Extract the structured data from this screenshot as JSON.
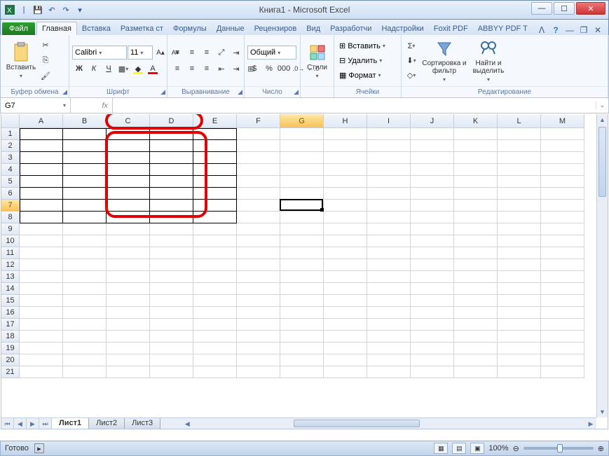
{
  "window": {
    "title": "Книга1  -  Microsoft Excel"
  },
  "qat": {
    "save": "💾",
    "undo": "↶",
    "redo": "↷"
  },
  "tabs": {
    "file": "Файл",
    "items": [
      "Главная",
      "Вставка",
      "Разметка ст",
      "Формулы",
      "Данные",
      "Рецензиров",
      "Вид",
      "Разработчи",
      "Надстройки",
      "Foxit PDF",
      "ABBYY PDF T"
    ],
    "active": 0
  },
  "ribbon": {
    "clipboard": {
      "paste": "Вставить",
      "label": "Буфер обмена"
    },
    "font": {
      "name": "Calibri",
      "size": "11",
      "bold": "Ж",
      "italic": "К",
      "underline": "Ч",
      "label": "Шрифт"
    },
    "align": {
      "label": "Выравнивание"
    },
    "number": {
      "format": "Общий",
      "label": "Число"
    },
    "styles": {
      "btn": "Стили"
    },
    "cells": {
      "insert": "Вставить",
      "delete": "Удалить",
      "format": "Формат",
      "label": "Ячейки"
    },
    "editing": {
      "sort": "Сортировка и фильтр",
      "find": "Найти и выделить",
      "label": "Редактирование"
    }
  },
  "formula": {
    "namebox": "G7",
    "fx": "fx",
    "value": ""
  },
  "grid": {
    "cols": [
      "A",
      "B",
      "C",
      "D",
      "E",
      "F",
      "G",
      "H",
      "I",
      "J",
      "K",
      "L",
      "M"
    ],
    "rows": [
      "1",
      "2",
      "3",
      "4",
      "5",
      "6",
      "7",
      "8",
      "9",
      "10",
      "11",
      "12",
      "13",
      "14",
      "15",
      "16",
      "17",
      "18",
      "19",
      "20",
      "21"
    ],
    "activeCell": "G7",
    "selectedColHeader": "G",
    "selectedRowHeader": "7",
    "borderedRange": {
      "r1": 1,
      "r2": 8,
      "c1": 0,
      "c2": 4
    }
  },
  "sheets": {
    "nav": [
      "⏮",
      "◀",
      "▶",
      "⏭"
    ],
    "tabs": [
      "Лист1",
      "Лист2",
      "Лист3"
    ],
    "active": 0
  },
  "status": {
    "ready": "Готово",
    "zoom": "100%"
  }
}
